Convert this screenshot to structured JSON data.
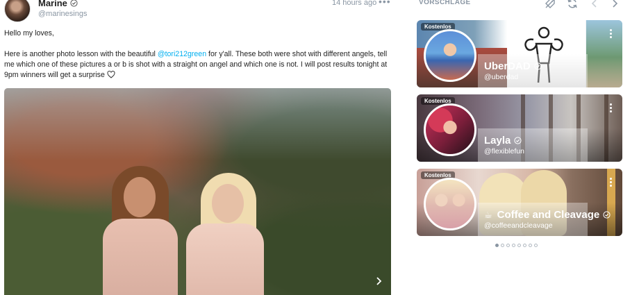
{
  "post": {
    "author_name": "Marine",
    "author_handle": "@marinesings",
    "timestamp": "14 hours ago",
    "greeting": "Hello my loves,",
    "body_before_mention": "Here is another photo lesson with the beautiful ",
    "mention": "@tori212green",
    "body_after_mention": " for y'all. These both were shot with different angels, tell me which one of these pictures a or b is shot with a straight on angel and which one is not. I will post results tonight at 9pm winners will get a surprise",
    "more_menu": "•••"
  },
  "suggestions": {
    "title": "VORSCHLÄGE",
    "cards": [
      {
        "badge": "Kostenlos",
        "name": "UberDAD",
        "handle": "@uberdad"
      },
      {
        "badge": "Kostenlos",
        "name": "Layla",
        "handle": "@flexiblefun"
      },
      {
        "badge": "Kostenlos",
        "cup": "☕",
        "name": "Coffee and Cleavage",
        "handle": "@coffeeandcleavage"
      }
    ],
    "pagination": {
      "total": 8,
      "active": 1
    }
  },
  "icons": {
    "verified": "verified-check-icon",
    "heart": "heart-outline-icon",
    "filter_off": "price-tag-off-icon",
    "refresh": "refresh-icon",
    "prev": "chevron-left-icon",
    "next": "chevron-right-icon"
  },
  "colors": {
    "link": "#00aff0",
    "muted": "#8a96a3"
  }
}
